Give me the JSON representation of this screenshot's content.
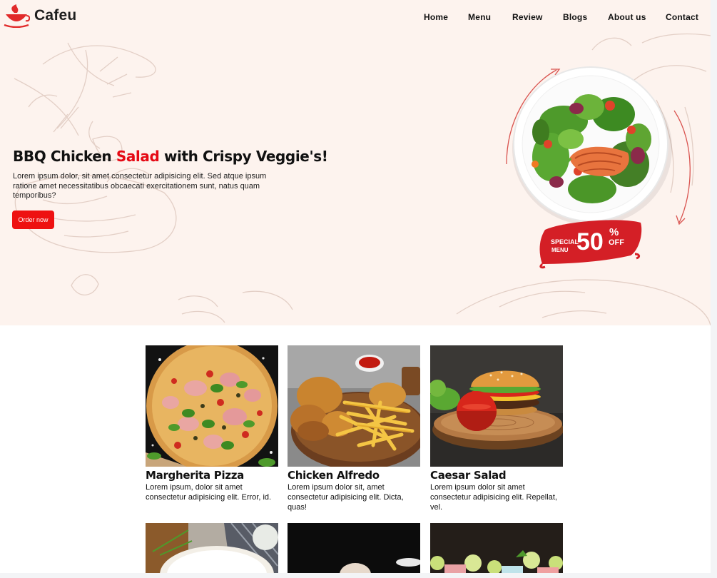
{
  "brand": {
    "name": "Cafeu",
    "logo_icon": "teacup-icon",
    "accent_color": "#e50914"
  },
  "nav": {
    "items": [
      {
        "label": "Home"
      },
      {
        "label": "Menu"
      },
      {
        "label": "Review"
      },
      {
        "label": "Blogs"
      },
      {
        "label": "About us"
      },
      {
        "label": "Contact"
      }
    ]
  },
  "hero": {
    "title_before": "BBQ Chicken ",
    "title_accent": "Salad",
    "title_after": " with Crispy Veggie's!",
    "description": "Lorem ipsum dolor, sit amet consectetur adipisicing elit. Sed atque ipsum ratione amet necessitatibus obcaecati exercitationem sunt, natus quam temporibus?",
    "cta_label": "Order now",
    "badge": {
      "top": "SPECIAL",
      "bottom": "MENU",
      "value": "50",
      "percent": "%",
      "off": "OFF"
    },
    "background_color": "#fdf3ee"
  },
  "menu": {
    "items": [
      {
        "title": "Margherita Pizza",
        "description": "Lorem ipsum, dolor sit amet consectetur adipisicing elit. Error, id."
      },
      {
        "title": "Chicken Alfredo",
        "description": "Lorem ipsum dolor sit, amet consectetur adipisicing elit. Dicta, quas!"
      },
      {
        "title": "Caesar Salad",
        "description": "Lorem ipsum dolor sit amet consectetur adipisicing elit. Repellat, vel."
      }
    ]
  }
}
